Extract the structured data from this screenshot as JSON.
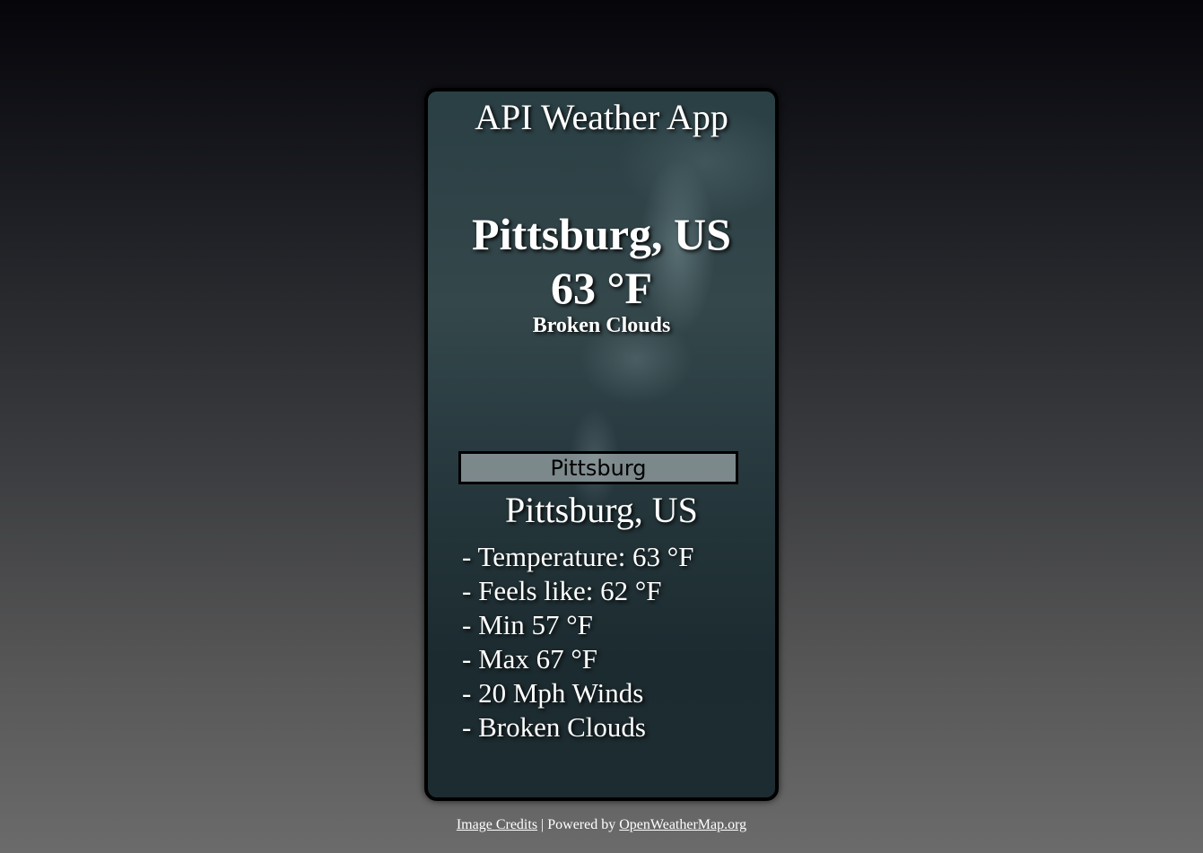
{
  "app": {
    "title": "API Weather App"
  },
  "current": {
    "location": "Pittsburg, US",
    "temperature": "63 °F",
    "description": "Broken Clouds"
  },
  "search": {
    "value": "Pittsburg"
  },
  "detail": {
    "location": "Pittsburg, US",
    "items": [
      "- Temperature: 63 °F",
      "- Feels like: 62 °F",
      "- Min 57 °F",
      "- Max 67 °F",
      "- 20 Mph Winds",
      "- Broken Clouds"
    ]
  },
  "footer": {
    "image_credits_link": "Image Credits",
    "separator": " | Powered by ",
    "powered_by_link": "OpenWeatherMap.org"
  },
  "colors": {
    "text": "#ffffff",
    "card_border": "#000000"
  }
}
